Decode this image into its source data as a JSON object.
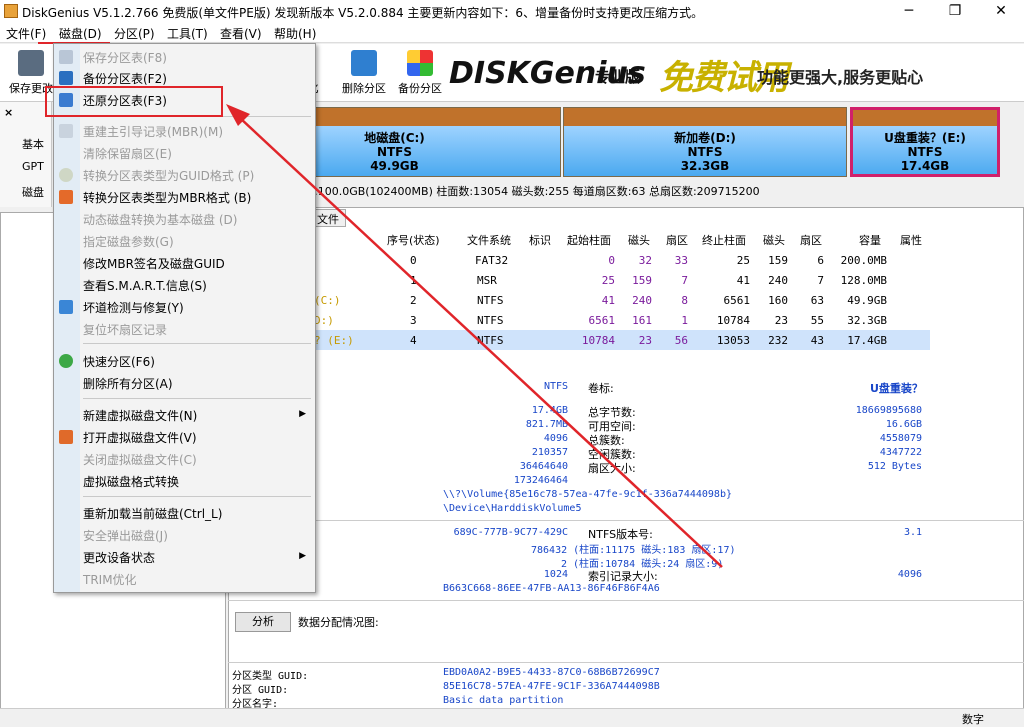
{
  "window": {
    "title": "DiskGenius V5.1.2.766 免费版(单文件PE版)   发现新版本 V5.2.0.884 主要更新内容如下：6、增量备份时支持更改压缩方式。",
    "minimize": "─",
    "maximize": "❐",
    "close": "✕"
  },
  "menubar": [
    "文件(F)",
    "磁盘(D)",
    "分区(P)",
    "工具(T)",
    "查看(V)",
    "帮助(H)"
  ],
  "toolbar": {
    "save": "保存更改",
    "delete_part": "删除分区",
    "backup_part": "备份分区",
    "hidden_left": "化"
  },
  "banner": {
    "logo": "DISKGenius",
    "edition": "专业版",
    "free": "免费试用",
    "slogan": "功能更强大,服务更贴心"
  },
  "left_strip": {
    "labels": [
      "基本",
      "GPT",
      "磁盘"
    ]
  },
  "partitions": [
    {
      "label": "地磁盘(C:)",
      "fs": "NTFS",
      "size": "49.9GB"
    },
    {
      "label": "新加卷(D:)",
      "fs": "NTFS",
      "size": "32.3GB"
    },
    {
      "label": "U盘重装？(E:)",
      "fs": "NTFS",
      "size": "17.4GB"
    }
  ],
  "disk_info": ":100.0GB(102400MB)  柱面数:13054  磁头数:255  每道扇区数:63  总扇区数:209715200",
  "tab": "文件",
  "table": {
    "headers": [
      "序号(状态)",
      "文件系统",
      "标识",
      "起始柱面",
      "磁头",
      "扇区",
      "终止柱面",
      "磁头",
      "扇区",
      "容量",
      "属性"
    ],
    "rows": [
      {
        "name": "",
        "idx": "0",
        "fs": "FAT32",
        "sc": "0",
        "sh": "32",
        "ss": "33",
        "ec": "25",
        "eh": "159",
        "es": "6",
        "cap": "200.0MB"
      },
      {
        "name": "",
        "idx": "1",
        "fs": "MSR",
        "sc": "25",
        "sh": "159",
        "ss": "7",
        "ec": "41",
        "eh": "240",
        "es": "7",
        "cap": "128.0MB"
      },
      {
        "name": "(C:)",
        "idx": "2",
        "fs": "NTFS",
        "sc": "41",
        "sh": "240",
        "ss": "8",
        "ec": "6561",
        "eh": "160",
        "es": "63",
        "cap": "49.9GB"
      },
      {
        "name": "D:)",
        "idx": "3",
        "fs": "NTFS",
        "sc": "6561",
        "sh": "161",
        "ss": "1",
        "ec": "10784",
        "eh": "23",
        "es": "55",
        "cap": "32.3GB"
      },
      {
        "name": "? (E:)",
        "idx": "4",
        "fs": "NTFS",
        "sc": "10784",
        "sh": "23",
        "ss": "56",
        "ec": "13053",
        "eh": "232",
        "es": "43",
        "cap": "17.4GB"
      }
    ]
  },
  "details": {
    "fs": "NTFS",
    "vol_label_k": "卷标:",
    "vol_label_v": "U盘重装？",
    "left_vals": [
      "17.4GB",
      "821.7MB",
      "4096",
      "210357",
      "36464640",
      "173246464"
    ],
    "right_keys": [
      "总字节数:",
      "可用空间:",
      "总簇数:",
      "空闲簇数:",
      "扇区大小:"
    ],
    "right_vals": [
      "18669895680",
      "16.6GB",
      "4558079",
      "4347722",
      "512 Bytes"
    ],
    "volume_path": "\\\\?\\Volume{85e16c78-57ea-47fe-9c1f-336a7444098b}",
    "device_path": "\\Device\\HarddiskVolume5",
    "serial": "689C-777B-9C77-429C",
    "ntfs_ver_k": "NTFS版本号:",
    "ntfs_ver_v": "3.1",
    "mft1": "786432 (柱面:11175 磁头:183 扇区:17)",
    "mft2": "2 (柱面:10784 磁头:24 扇区:9)",
    "idx_k": "索引记录大小:",
    "idx_v": "4096",
    "idx_left": "1024",
    "guid2": "B663C668-86EE-47FB-AA13-86F46F86F4A6"
  },
  "analyze": {
    "button": "分析",
    "label": "数据分配情况图:"
  },
  "guids": [
    {
      "k": "分区类型 GUID:",
      "v": "EBD0A0A2-B9E5-4433-87C0-68B6B72699C7"
    },
    {
      "k": "分区 GUID:",
      "v": "85E16C78-57EA-47FE-9C1F-336A7444098B"
    },
    {
      "k": "分区名字:",
      "v": "Basic data partition"
    }
  ],
  "status": {
    "numlock": "数字"
  },
  "dropdown": [
    {
      "label": "保存分区表(F8)",
      "dis": true
    },
    {
      "label": "备份分区表(F2)",
      "dis": false
    },
    {
      "label": "还原分区表(F3)",
      "dis": false
    },
    {
      "label": "重建主引导记录(MBR)(M)",
      "dis": true
    },
    {
      "label": "清除保留扇区(E)",
      "dis": true
    },
    {
      "label": "转换分区表类型为GUID格式 (P)",
      "dis": true
    },
    {
      "label": "转换分区表类型为MBR格式 (B)",
      "dis": false
    },
    {
      "label": "动态磁盘转换为基本磁盘 (D)",
      "dis": true
    },
    {
      "label": "指定磁盘参数(G)",
      "dis": true
    },
    {
      "label": "修改MBR签名及磁盘GUID",
      "dis": false
    },
    {
      "label": "查看S.M.A.R.T.信息(S)",
      "dis": false
    },
    {
      "label": "坏道检测与修复(Y)",
      "dis": false
    },
    {
      "label": "复位坏扇区记录",
      "dis": true
    },
    {
      "label": "快速分区(F6)",
      "dis": false
    },
    {
      "label": "删除所有分区(A)",
      "dis": false
    },
    {
      "label": "新建虚拟磁盘文件(N)",
      "dis": false
    },
    {
      "label": "打开虚拟磁盘文件(V)",
      "dis": false
    },
    {
      "label": "关闭虚拟磁盘文件(C)",
      "dis": true
    },
    {
      "label": "虚拟磁盘格式转换",
      "dis": false
    },
    {
      "label": "重新加载当前磁盘(Ctrl_L)",
      "dis": false
    },
    {
      "label": "安全弹出磁盘(J)",
      "dis": true
    },
    {
      "label": "更改设备状态",
      "dis": false
    },
    {
      "label": "TRIM优化",
      "dis": true
    }
  ]
}
